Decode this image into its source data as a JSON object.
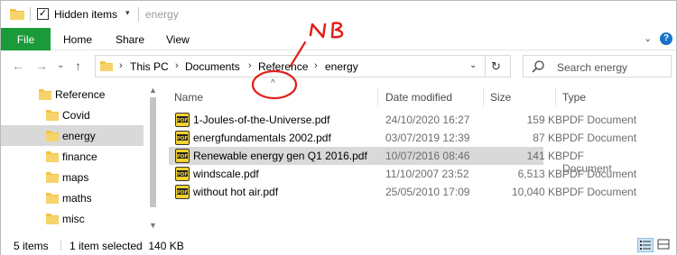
{
  "titlebar": {
    "hidden_items_label": "Hidden items",
    "hidden_items_checked": true,
    "title": "energy"
  },
  "ribbon": {
    "tabs": [
      "File",
      "Home",
      "Share",
      "View"
    ]
  },
  "address": {
    "crumbs": [
      "This PC",
      "Documents",
      "Reference",
      "energy"
    ]
  },
  "search": {
    "placeholder": "Search energy"
  },
  "nav": {
    "items": [
      {
        "label": "Reference",
        "selected": false,
        "level": 0
      },
      {
        "label": "Covid",
        "selected": false,
        "level": 1
      },
      {
        "label": "energy",
        "selected": true,
        "level": 1
      },
      {
        "label": "finance",
        "selected": false,
        "level": 1
      },
      {
        "label": "maps",
        "selected": false,
        "level": 1
      },
      {
        "label": "maths",
        "selected": false,
        "level": 1
      },
      {
        "label": "misc",
        "selected": false,
        "level": 1
      }
    ]
  },
  "columns": {
    "name": "Name",
    "date": "Date modified",
    "size": "Size",
    "type": "Type"
  },
  "files": [
    {
      "name": "1-Joules-of-the-Universe.pdf",
      "date": "24/10/2020 16:27",
      "size": "159 KB",
      "type": "PDF Document",
      "selected": false
    },
    {
      "name": "energfundamentals 2002.pdf",
      "date": "03/07/2019 12:39",
      "size": "87 KB",
      "type": "PDF Document",
      "selected": false
    },
    {
      "name": "Renewable energy gen Q1 2016.pdf",
      "date": "10/07/2016 08:46",
      "size": "141 KB",
      "type": "PDF Document",
      "selected": true
    },
    {
      "name": "windscale.pdf",
      "date": "11/10/2007 23:52",
      "size": "6,513 KB",
      "type": "PDF Document",
      "selected": false
    },
    {
      "name": "without hot air.pdf",
      "date": "25/05/2010 17:09",
      "size": "10,040 KB",
      "type": "PDF Document",
      "selected": false
    }
  ],
  "status": {
    "items_count": "5 items",
    "selection": "1 item selected  140 KB"
  },
  "annotation": {
    "text": "NB"
  },
  "colors": {
    "file_tab": "#1a9a3a",
    "selection": "#d9d9d9",
    "folder": "#f3c344",
    "annotation": "#e0201a"
  },
  "icons": {
    "folder": "folder-icon",
    "pdf": "pdf-icon",
    "search": "search-icon",
    "refresh": "refresh-icon",
    "help": "help-icon"
  }
}
